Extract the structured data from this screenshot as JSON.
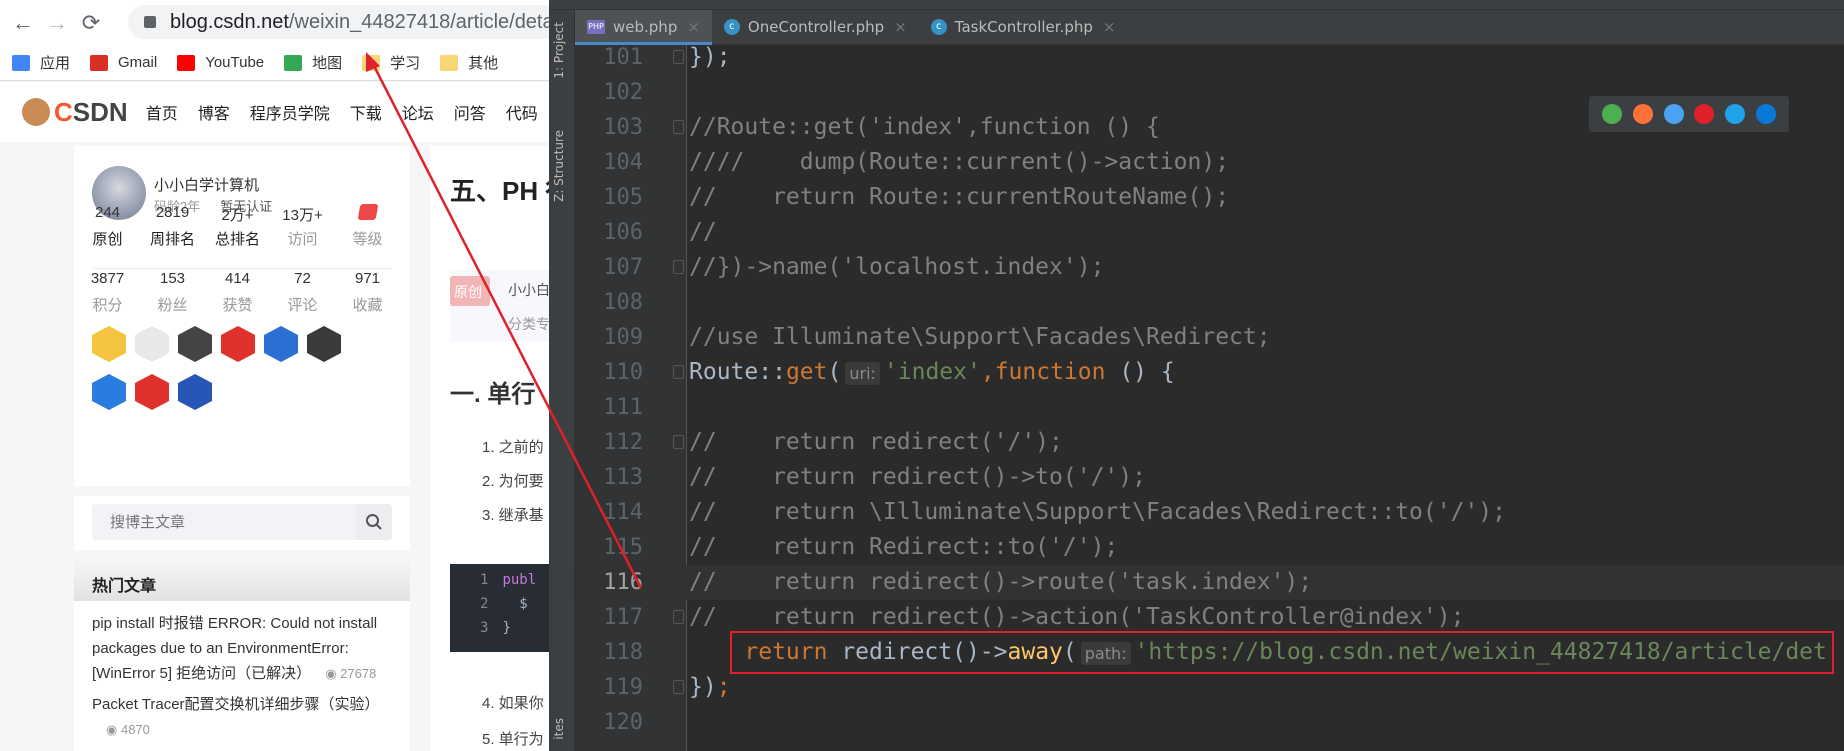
{
  "browser": {
    "url_host": "blog.csdn.net",
    "url_path": "/weixin_44827418/article/detail",
    "bookmarks": [
      {
        "label": "应用",
        "icon": "apps-grid-icon",
        "color": "#4285f4"
      },
      {
        "label": "Gmail",
        "icon": "gmail-icon",
        "color": "#d93025"
      },
      {
        "label": "YouTube",
        "icon": "youtube-icon",
        "color": "#ff0000"
      },
      {
        "label": "地图",
        "icon": "maps-icon",
        "color": "#34a853"
      },
      {
        "label": "学习",
        "icon": "folder-icon",
        "color": "#f7d774"
      },
      {
        "label": "其他",
        "icon": "folder-icon",
        "color": "#f7d774"
      }
    ]
  },
  "csdn": {
    "logo": "CSDN",
    "nav": [
      "首页",
      "博客",
      "程序员学院",
      "下载",
      "论坛",
      "问答",
      "代码"
    ],
    "profile": {
      "name": "小小白学计算机",
      "age": "码龄2年",
      "cert": "暂无认证",
      "stats_row1": [
        {
          "value": "244",
          "label": "原创"
        },
        {
          "value": "2819",
          "label": "周排名"
        },
        {
          "value": "2万+",
          "label": "总排名"
        },
        {
          "value": "13万+",
          "label": "访问"
        },
        {
          "value": "",
          "label": "等级"
        }
      ],
      "stats_row2": [
        {
          "value": "3877",
          "label": "积分"
        },
        {
          "value": "153",
          "label": "粉丝"
        },
        {
          "value": "414",
          "label": "获赞"
        },
        {
          "value": "72",
          "label": "评论"
        },
        {
          "value": "971",
          "label": "收藏"
        }
      ],
      "badge_colors": [
        "#f5c542",
        "#e8e8e8",
        "#444444",
        "#e0312d",
        "#2a6fd1",
        "#3a3a3a",
        "#2c7be0",
        "#e0312d",
        "#2855b8"
      ]
    },
    "search_placeholder": "搜博主文章",
    "hot_title": "热门文章",
    "hot_articles": [
      {
        "title": "pip install 时报错 ERROR: Could not install packages due to an EnvironmentError: [WinError 5] 拒绝访问（已解决）",
        "views": "27678"
      },
      {
        "title": "Packet Tracer配置交换机详细步骤（实验）",
        "views": "4870"
      }
    ],
    "article": {
      "title": "五、PH 行为",
      "orig_badge": "原创",
      "author": "小小白",
      "category": "分类专",
      "heading": "一. 单行",
      "items": [
        "1. 之前的",
        "2. 为何要",
        "3. 继承基",
        "4. 如果你",
        "5. 单行为"
      ],
      "snippet_lines": [
        {
          "n": "1",
          "t": "publ"
        },
        {
          "n": "2",
          "t": "  $"
        },
        {
          "n": "3",
          "t": "}"
        }
      ]
    }
  },
  "ide": {
    "tabs": [
      {
        "label": "web.php",
        "icon": "php-file-icon",
        "active": true
      },
      {
        "label": "OneController.php",
        "icon": "class-icon",
        "active": false
      },
      {
        "label": "TaskController.php",
        "icon": "class-icon",
        "active": false
      }
    ],
    "side_labels": [
      "1: Project",
      "Z: Structure",
      "ites"
    ],
    "current_line": "116",
    "lines": [
      {
        "n": "101",
        "fold": true,
        "tokens": [
          {
            "t": "});",
            "c": "df"
          }
        ]
      },
      {
        "n": "102",
        "tokens": []
      },
      {
        "n": "103",
        "fold": true,
        "tokens": [
          {
            "t": "//Route::get('index',function () {",
            "c": "cm"
          }
        ]
      },
      {
        "n": "104",
        "tokens": [
          {
            "t": "////    dump(Route::current()->action);",
            "c": "cm"
          }
        ]
      },
      {
        "n": "105",
        "tokens": [
          {
            "t": "//    return Route::currentRouteName();",
            "c": "cm"
          }
        ]
      },
      {
        "n": "106",
        "tokens": [
          {
            "t": "//",
            "c": "cm"
          }
        ]
      },
      {
        "n": "107",
        "fold": true,
        "tokens": [
          {
            "t": "//})->name('localhost.index');",
            "c": "cm"
          }
        ]
      },
      {
        "n": "108",
        "tokens": []
      },
      {
        "n": "109",
        "tokens": [
          {
            "t": "//use Illuminate\\Support\\Facades\\Redirect;",
            "c": "cm"
          }
        ]
      },
      {
        "n": "110",
        "fold": true,
        "tokens": [
          {
            "t": "Route::",
            "c": "df"
          },
          {
            "t": "get",
            "c": "kw"
          },
          {
            "t": "(",
            "c": "df"
          },
          {
            "t": "uri:",
            "c": "hint"
          },
          {
            "t": "'index'",
            "c": "st"
          },
          {
            "t": ",function ",
            "c": "kw"
          },
          {
            "t": "() {",
            "c": "df"
          }
        ]
      },
      {
        "n": "111",
        "tokens": []
      },
      {
        "n": "112",
        "fold": true,
        "tokens": [
          {
            "t": "//    return redirect('/');",
            "c": "cm"
          }
        ]
      },
      {
        "n": "113",
        "tokens": [
          {
            "t": "//    return redirect()->to('/');",
            "c": "cm"
          }
        ]
      },
      {
        "n": "114",
        "tokens": [
          {
            "t": "//    return \\Illuminate\\Support\\Facades\\Redirect::to('/');",
            "c": "cm"
          }
        ]
      },
      {
        "n": "115",
        "tokens": [
          {
            "t": "//    return Redirect::to('/');",
            "c": "cm"
          }
        ]
      },
      {
        "n": "116",
        "tokens": [
          {
            "t": "//    return redirect()->route('task.index');",
            "c": "cm"
          }
        ]
      },
      {
        "n": "117",
        "fold": true,
        "tokens": [
          {
            "t": "//    return redirect()->action('TaskController@index');",
            "c": "cm"
          }
        ]
      },
      {
        "n": "118",
        "tokens": [
          {
            "t": "    return ",
            "c": "kw"
          },
          {
            "t": "redirect()->",
            "c": "df"
          },
          {
            "t": "away",
            "c": "fn"
          },
          {
            "t": "(",
            "c": "df"
          },
          {
            "t": "path:",
            "c": "hint"
          },
          {
            "t": "'https://blog.csdn.net/weixin_44827418/article/det",
            "c": "st"
          }
        ]
      },
      {
        "n": "119",
        "fold": true,
        "tokens": [
          {
            "t": "})",
            "c": "df"
          },
          {
            "t": ";",
            "c": "kw"
          }
        ]
      },
      {
        "n": "120",
        "tokens": []
      }
    ],
    "browser_icons": [
      {
        "name": "chrome-icon",
        "color": "#4caf50"
      },
      {
        "name": "firefox-icon",
        "color": "#ff7139"
      },
      {
        "name": "safari-icon",
        "color": "#4aa3f0"
      },
      {
        "name": "opera-icon",
        "color": "#e0202a"
      },
      {
        "name": "ie-icon",
        "color": "#1fa3e8"
      },
      {
        "name": "edge-icon",
        "color": "#0a78d7"
      }
    ]
  },
  "annotation": {
    "color": "#e0202a"
  }
}
